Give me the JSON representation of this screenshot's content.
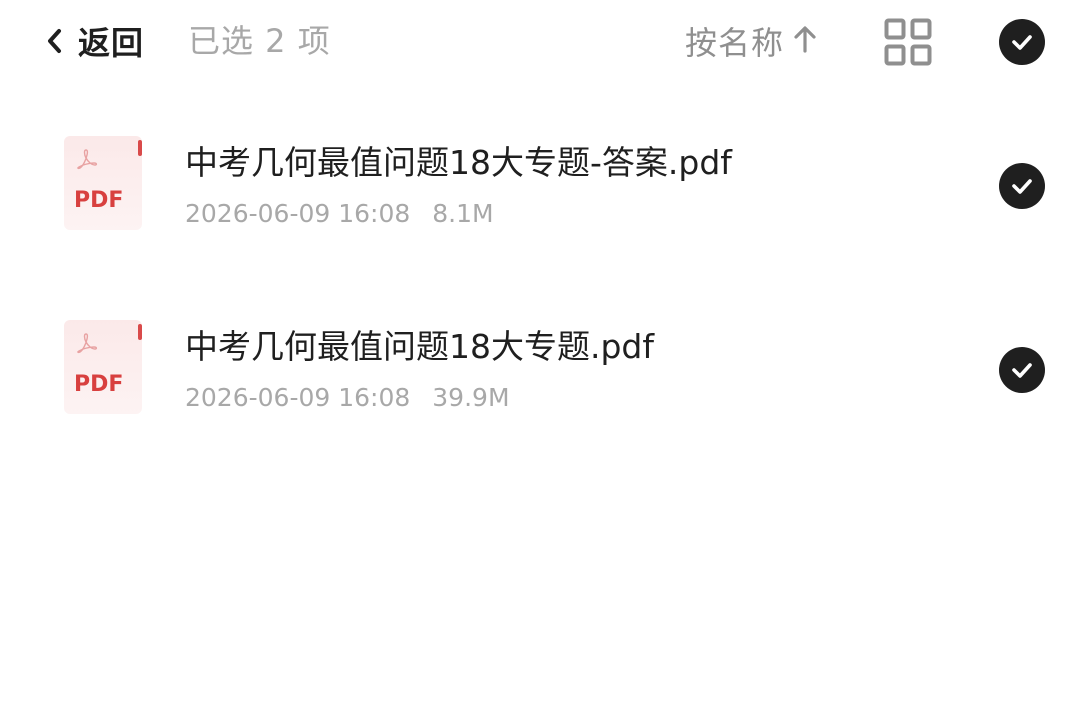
{
  "header": {
    "back_label": "返回",
    "selected_text": "已选 2 项",
    "sort_label": "按名称",
    "sort_direction_icon": "arrow-up-icon",
    "view_toggle_icon": "grid-view-icon",
    "select_all_icon": "check-circle-icon",
    "select_all_checked": true
  },
  "files": [
    {
      "name": "中考几何最值问题18大专题-答案.pdf",
      "date": "2026-06-09 16:08",
      "size": "8.1M",
      "type_label": "PDF",
      "checked": true
    },
    {
      "name": "中考几何最值问题18大专题.pdf",
      "date": "2026-06-09 16:08",
      "size": "39.9M",
      "type_label": "PDF",
      "checked": true
    }
  ],
  "colors": {
    "text_primary": "#1f1f1f",
    "text_secondary": "#a8a8a8",
    "sort_text": "#8f8f8f",
    "pdf_red": "#d8403f",
    "check_fill": "#1f1f1f"
  }
}
